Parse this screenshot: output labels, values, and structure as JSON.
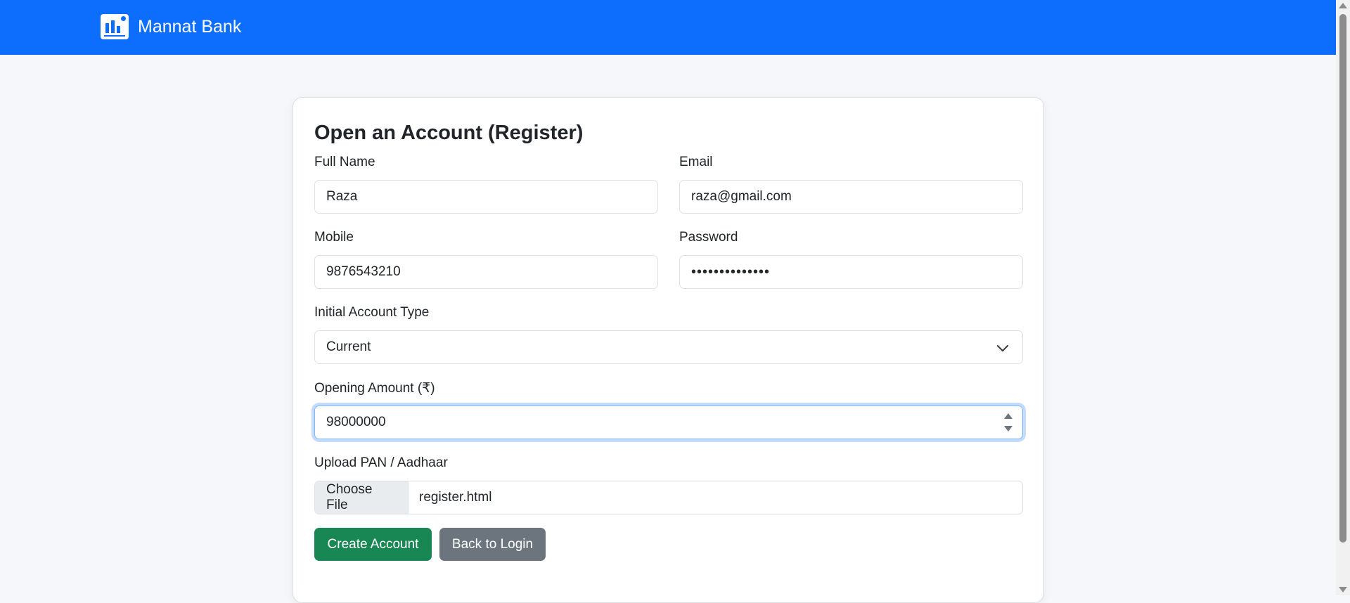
{
  "navbar": {
    "brand": "Mannat Bank",
    "logo_icon": "bank-chart-logo-icon",
    "color": "#0d6efd"
  },
  "form": {
    "title": "Open an Account (Register)",
    "full_name": {
      "label": "Full Name",
      "value": "Raza"
    },
    "email": {
      "label": "Email",
      "value": "raza@gmail.com"
    },
    "mobile": {
      "label": "Mobile",
      "value": "9876543210"
    },
    "password": {
      "label": "Password",
      "value": "••••••••••••••"
    },
    "account_type": {
      "label": "Initial Account Type",
      "value": "Current"
    },
    "opening_amount": {
      "label": "Opening Amount (₹)",
      "value": "98000000"
    },
    "upload": {
      "label": "Upload PAN / Aadhaar",
      "button": "Choose File",
      "filename": "register.html"
    },
    "create_button": "Create Account",
    "back_button": "Back to Login"
  },
  "colors": {
    "primary": "#0d6efd",
    "success": "#198754",
    "secondary": "#6c757d"
  }
}
